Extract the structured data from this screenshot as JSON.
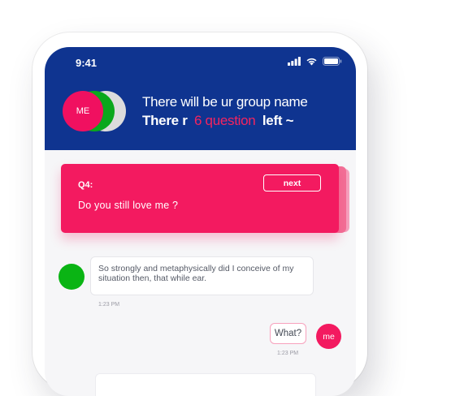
{
  "status_bar": {
    "time": "9:41",
    "icons": [
      "signal-icon",
      "wifi-icon",
      "battery-icon"
    ]
  },
  "header": {
    "avatar_label": "ME",
    "group_name": "There will be ur group name",
    "questions_prefix": "There r",
    "questions_count": "6 question",
    "questions_suffix": "left ~"
  },
  "question_card": {
    "number": "Q4:",
    "text": "Do you still love me ?",
    "next_label": "next"
  },
  "messages": [
    {
      "text": "So strongly and metaphysically did I conceive of my situation then, that while ear.",
      "time": "1:23 PM"
    },
    {
      "text": "What?",
      "avatar_label": "me",
      "time": "1:23 PM"
    }
  ],
  "colors": {
    "header_bg": "#0f3490",
    "accent_pink": "#f31a60",
    "green": "#0ab414"
  }
}
